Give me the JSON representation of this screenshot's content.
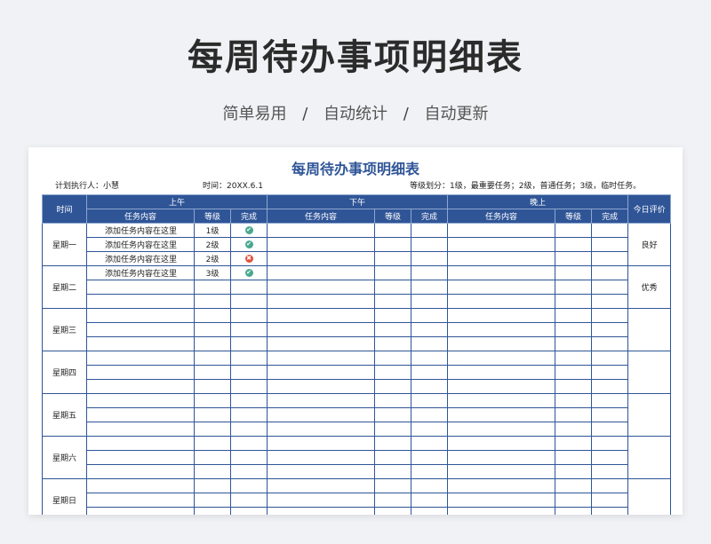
{
  "header": {
    "title": "每周待办事项明细表",
    "subtitle_parts": [
      "简单易用",
      "自动统计",
      "自动更新"
    ],
    "separator": "/"
  },
  "sheet": {
    "title": "每周待办事项明细表",
    "planner": "计划执行人：小慧",
    "date": "时间：20XX.6.1",
    "grade_note": "等级划分：1级，最重要任务；2级，普通任务；3级，临时任务。",
    "col_time": "时间",
    "morning": "上午",
    "afternoon": "下午",
    "evening": "晚上",
    "rating": "今日评价",
    "sub_task": "任务内容",
    "sub_level": "等级",
    "sub_done": "完成",
    "days": [
      {
        "name": "星期一",
        "rating": "良好",
        "rows": [
          {
            "task": "添加任务内容在这里",
            "level": "1级",
            "done": "check"
          },
          {
            "task": "添加任务内容在这里",
            "level": "2级",
            "done": "check"
          },
          {
            "task": "添加任务内容在这里",
            "level": "2级",
            "done": "cross"
          }
        ]
      },
      {
        "name": "星期二",
        "rating": "优秀",
        "rows": [
          {
            "task": "添加任务内容在这里",
            "level": "3级",
            "done": "check"
          }
        ]
      },
      {
        "name": "星期三",
        "rating": "",
        "rows": []
      },
      {
        "name": "星期四",
        "rating": "",
        "rows": []
      },
      {
        "name": "星期五",
        "rating": "",
        "rows": []
      },
      {
        "name": "星期六",
        "rating": "",
        "rows": []
      },
      {
        "name": "星期日",
        "rating": "",
        "rows": []
      }
    ]
  },
  "colors": {
    "header_blue": "#2f5597",
    "check_green": "#4aa890",
    "cross_red": "#e0533f"
  },
  "icons": {
    "check": "check-circle-icon",
    "cross": "cross-circle-icon"
  }
}
